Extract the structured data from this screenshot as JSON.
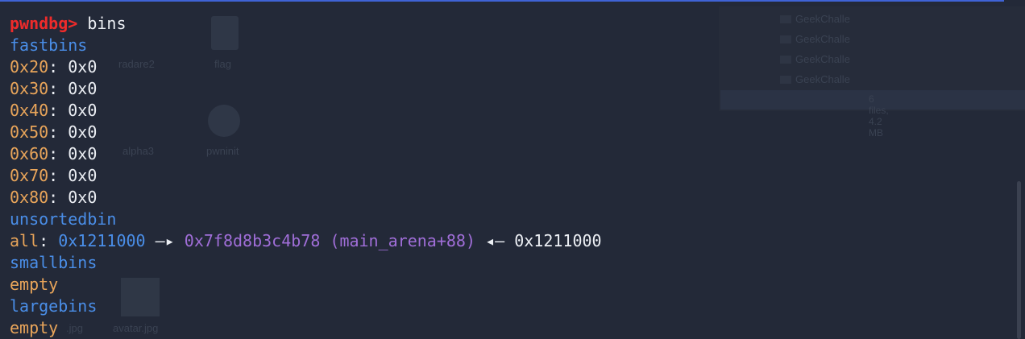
{
  "colors": {
    "background": "#232938",
    "prompt": "#ee2b2b",
    "bin_header": "#4a8ee8",
    "size": "#e9a55a",
    "pointer": "#a06ed8",
    "text": "#eceff4",
    "top_border": "#3f63d6"
  },
  "desktop": {
    "labels": [
      "radare2",
      "flag",
      "alpha3",
      "pwninit",
      "avatar.jpg",
      ".jpg"
    ],
    "folders": [
      "GeekChalle",
      "GeekChalle",
      "GeekChalle",
      "GeekChalle"
    ],
    "status": "6 files, 4.2 MB"
  },
  "terminal": {
    "prompt": "pwndbg>",
    "command": "bins",
    "fastbins_label": "fastbins",
    "fastbins": [
      {
        "size": "0x20",
        "value": "0x0"
      },
      {
        "size": "0x30",
        "value": "0x0"
      },
      {
        "size": "0x40",
        "value": "0x0"
      },
      {
        "size": "0x50",
        "value": "0x0"
      },
      {
        "size": "0x60",
        "value": "0x0"
      },
      {
        "size": "0x70",
        "value": "0x0"
      },
      {
        "size": "0x80",
        "value": "0x0"
      }
    ],
    "unsortedbin_label": "unsortedbin",
    "unsorted": {
      "key": "all",
      "chunk": "0x1211000",
      "arrow_right": "—▸",
      "target": "0x7f8d8b3c4b78 (main_arena+88)",
      "arrow_left": "◂—",
      "back": "0x1211000"
    },
    "smallbins_label": "smallbins",
    "smallbins_value": "empty",
    "largebins_label": "largebins",
    "largebins_value": "empty"
  }
}
